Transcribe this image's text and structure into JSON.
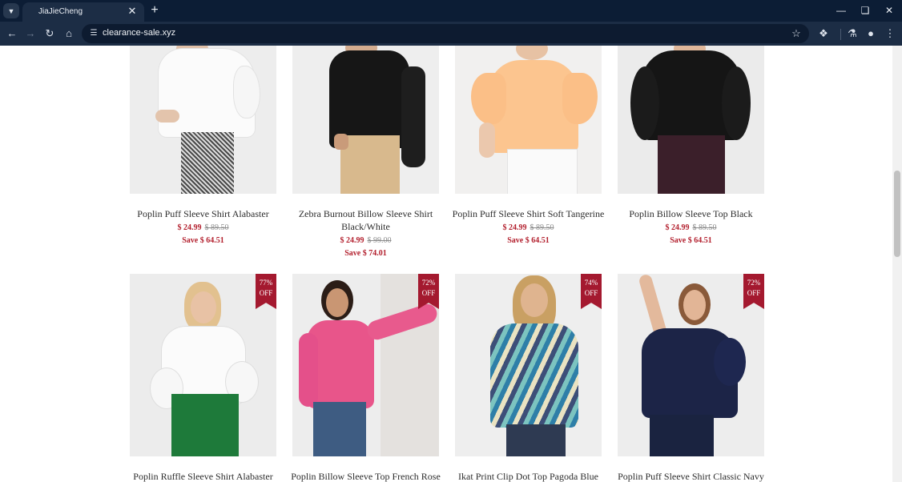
{
  "browser": {
    "tab_title": "JiaJieCheng",
    "url": "clearance-sale.xyz",
    "icons": {
      "tab_menu": "chevron-down-icon",
      "tab_close": "close-icon",
      "new_tab": "plus-icon",
      "minimize": "minimize-icon",
      "restore": "restore-icon",
      "close_window": "close-icon",
      "back": "arrow-left-icon",
      "forward": "arrow-right-icon",
      "reload": "reload-icon",
      "home": "home-icon",
      "site_info": "tune-icon",
      "bookmark": "star-icon",
      "extensions": "puzzle-icon",
      "labs": "flask-icon",
      "profile": "person-icon",
      "menu": "kebab-menu-icon"
    }
  },
  "products_row1": [
    {
      "name": "Poplin Puff Sleeve Shirt Alabaster",
      "price": "$ 24.99",
      "original": "$ 89.50",
      "save": "Save $ 64.51"
    },
    {
      "name": "Zebra Burnout Billow Sleeve Shirt Black/White",
      "price": "$ 24.99",
      "original": "$ 99.00",
      "save": "Save $ 74.01"
    },
    {
      "name": "Poplin Puff Sleeve Shirt Soft Tangerine",
      "price": "$ 24.99",
      "original": "$ 89.50",
      "save": "Save $ 64.51"
    },
    {
      "name": "Poplin Billow Sleeve Top Black",
      "price": "$ 24.99",
      "original": "$ 89.50",
      "save": "Save $ 64.51"
    }
  ],
  "products_row2": [
    {
      "name": "Poplin Ruffle Sleeve Shirt Alabaster",
      "badge_pct": "77%",
      "badge_off": "OFF"
    },
    {
      "name": "Poplin Billow Sleeve Top French Rose",
      "badge_pct": "72%",
      "badge_off": "OFF"
    },
    {
      "name": "Ikat Print Clip Dot Top Pagoda Blue",
      "badge_pct": "74%",
      "badge_off": "OFF"
    },
    {
      "name": "Poplin Puff Sleeve Shirt Classic Navy",
      "badge_pct": "72%",
      "badge_off": "OFF"
    }
  ],
  "colors": {
    "sale_red": "#b3202e",
    "badge_red": "#a4192f",
    "chrome_dark": "#0c1d35",
    "toolbar": "#1c2d45"
  }
}
